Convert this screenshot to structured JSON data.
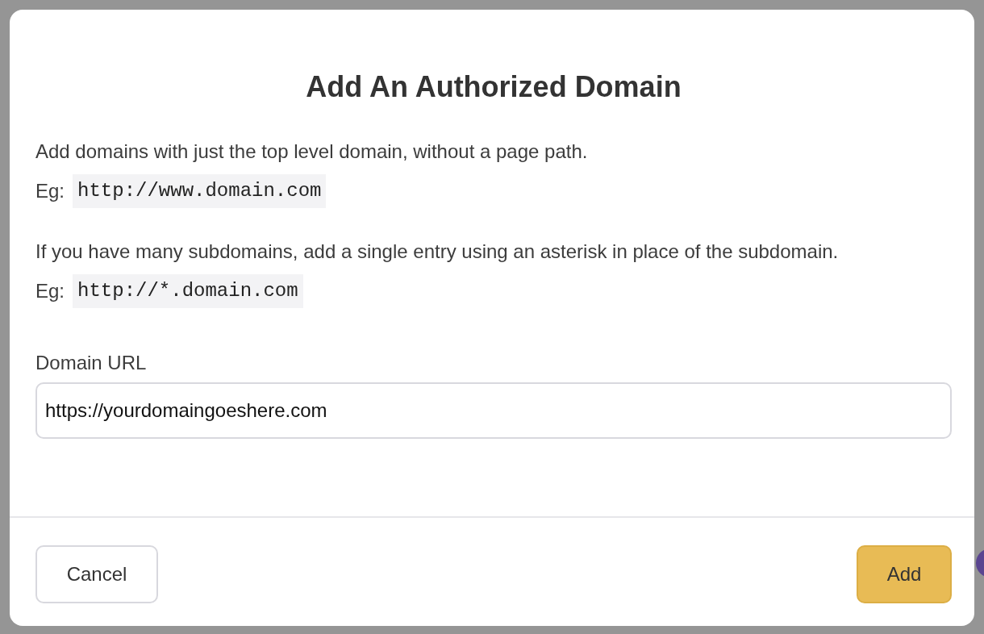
{
  "dialog": {
    "title": "Add An Authorized Domain",
    "paragraphs": [
      {
        "kind": "text",
        "text": "Add domains with just the top level domain, without a page path."
      },
      {
        "kind": "example",
        "label": "Eg:",
        "code": "http://www.domain.com"
      },
      {
        "kind": "text",
        "text": "If you have many subdomains, add a single entry using an asterisk in place of the subdomain."
      },
      {
        "kind": "example",
        "label": "Eg:",
        "code": "http://*.domain.com"
      }
    ],
    "field": {
      "label": "Domain URL",
      "value": "https://yourdomaingoeshere.com"
    },
    "buttons": [
      {
        "kind": "secondary",
        "label": "Cancel"
      },
      {
        "kind": "primary",
        "label": "Add"
      }
    ]
  }
}
